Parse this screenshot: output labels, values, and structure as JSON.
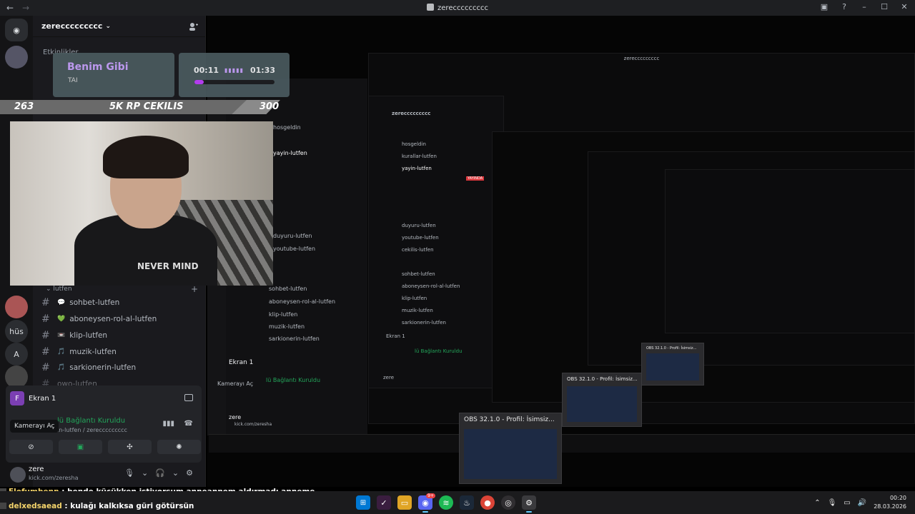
{
  "titlebar": {
    "title": "zereccccccccc",
    "back": "←",
    "forward": "→"
  },
  "guild": {
    "name": "zereccccccccc",
    "events_label": "Etkinlikler"
  },
  "rail_labels": {
    "hus": "hüs",
    "a": "A"
  },
  "channels": [
    {
      "emoji": "💬",
      "name": "sohbet-lutfen"
    },
    {
      "emoji": "💚",
      "name": "aboneysen-rol-al-lutfen"
    },
    {
      "emoji": "📼",
      "name": "klip-lutfen"
    },
    {
      "emoji": "🎵",
      "name": "muzik-lutfen"
    },
    {
      "emoji": "🎵",
      "name": "sarkionerin-lutfen"
    },
    {
      "emoji": "",
      "name": "owo-lutfen"
    }
  ],
  "category": "lutfen",
  "voice": {
    "title": "Ekran 1",
    "avatar_letter": "F",
    "connection": "lü Bağlantı Kuruldu",
    "channel": "in-lutfen / zereccccccccc",
    "tooltip": "Kamerayı Aç"
  },
  "user": {
    "name": "zere",
    "status": "kick.com/zeresha"
  },
  "overlay": {
    "song": "Benim Gibi",
    "artist": "TAI",
    "elapsed": "00:11",
    "total": "01:33",
    "progress": 0.12,
    "goal_left": "263",
    "goal_title": "5K RP CEKILIS",
    "goal_right": "300",
    "shirt_text": "NEVER MIND"
  },
  "nested": {
    "title": "zereccccccccc",
    "voice_title": "Ekran 1",
    "camera_label": "Kamerayı Aç",
    "connection": "lü Bağlantı Kuruldu",
    "user": "zere",
    "user_status": "kick.com/zeresha",
    "channels": [
      "hosgeldin",
      "kurallar-lutfen",
      "yayin-lutfen",
      "duyuru-lutfen",
      "youtube-lutfen",
      "cekilis-lutfen",
      "sohbet-lutfen",
      "aboneysen-rol-al-lutfen",
      "klip-lutfen",
      "muzik-lutfen",
      "sarkionerin-lutfen"
    ],
    "live_badge": "YAYINDA"
  },
  "obs_windows": [
    {
      "title": "OBS 32.1.0 - Profil: İsimsiz..."
    },
    {
      "title": "OBS 32.1.0 - Profil: İsimsiz..."
    },
    {
      "title": "OBS 32.1.0 - Profil: İsimsiz..."
    }
  ],
  "chat": [
    {
      "nick": "Elofumbenn",
      "message": ": bende küçükken istiyorsum anneannem aldırmadı anneme"
    },
    {
      "nick": "delxedsaead",
      "message": ": kulağı kalkıksa güri götürsün"
    }
  ],
  "taskbar": {
    "time": "00:20",
    "date": "28.03.2026",
    "discord_badge": "9+"
  }
}
